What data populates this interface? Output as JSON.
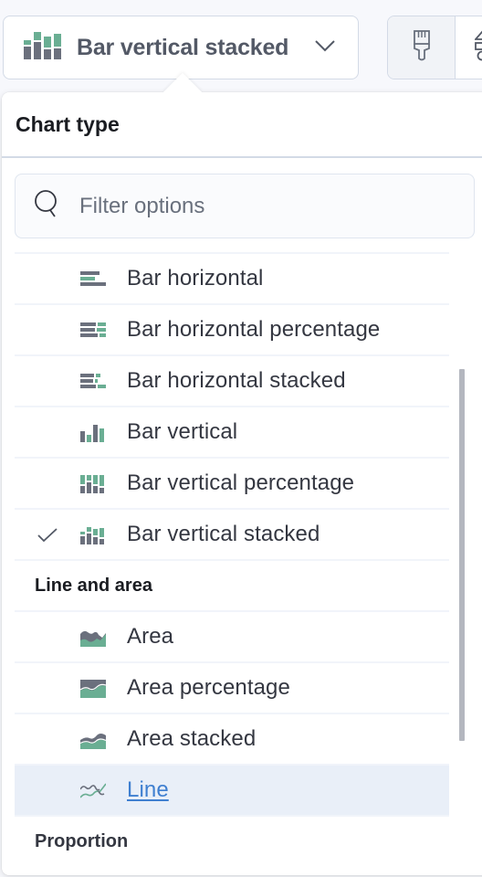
{
  "toolbar": {
    "chart_switch_label": "Bar vertical stacked",
    "chart_switch_icon": "bar-vertical-stacked-icon",
    "style_button_icon": "paintbrush-icon",
    "layers_button_icon": "layers-icon"
  },
  "popover": {
    "title": "Chart type",
    "search": {
      "value": "",
      "placeholder": "Filter options",
      "icon": "search-icon"
    },
    "items": [
      {
        "label": "Bar horizontal",
        "icon": "bar-horizontal-icon",
        "selected": false
      },
      {
        "label": "Bar horizontal percentage",
        "icon": "bar-horizontal-percentage-icon",
        "selected": false
      },
      {
        "label": "Bar horizontal stacked",
        "icon": "bar-horizontal-stacked-icon",
        "selected": false
      },
      {
        "label": "Bar vertical",
        "icon": "bar-vertical-icon",
        "selected": false
      },
      {
        "label": "Bar vertical percentage",
        "icon": "bar-vertical-percentage-icon",
        "selected": false
      },
      {
        "label": "Bar vertical stacked",
        "icon": "bar-vertical-stacked-icon",
        "selected": true
      }
    ],
    "groups": [
      {
        "title": "Line and area",
        "items": [
          {
            "label": "Area",
            "icon": "area-icon",
            "selected": false
          },
          {
            "label": "Area percentage",
            "icon": "area-percentage-icon",
            "selected": false
          },
          {
            "label": "Area stacked",
            "icon": "area-stacked-icon",
            "selected": false
          },
          {
            "label": "Line",
            "icon": "line-icon",
            "selected": false,
            "highlighted": true
          }
        ]
      },
      {
        "title": "Proportion",
        "items": []
      }
    ]
  },
  "colors": {
    "accent_green": "#6dccb1",
    "icon_gray": "#69707d",
    "link_blue": "#3f7fd0",
    "highlight_bg": "#e9eff8"
  }
}
